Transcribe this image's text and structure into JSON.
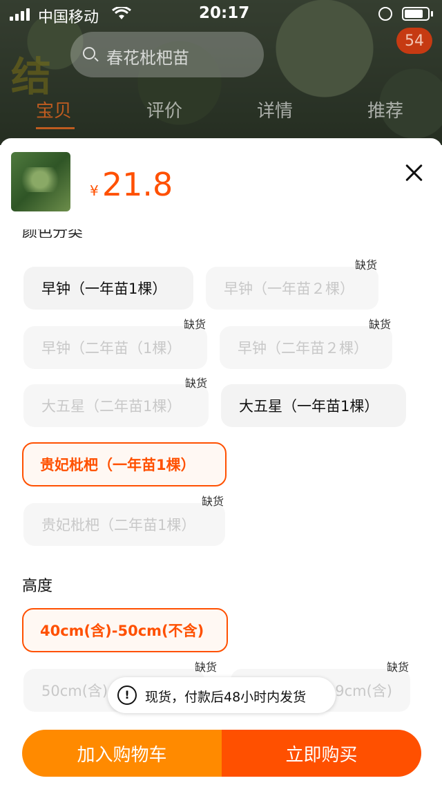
{
  "status_bar": {
    "carrier": "中国移动",
    "time": "20:17"
  },
  "background_page": {
    "search_placeholder": "春花枇杷苗",
    "cart_count": "54",
    "tabs": [
      "宝贝",
      "评价",
      "详情",
      "推荐"
    ],
    "active_tab": "宝贝",
    "watermark": "结"
  },
  "sheet": {
    "price_symbol": "¥",
    "price": "21.8",
    "section_color": "颜色分类",
    "color_options": [
      {
        "label": "早钟（一年苗1棵）",
        "state": "available"
      },
      {
        "label": "早钟（一年苗２棵）",
        "state": "disabled",
        "tag": "缺货"
      },
      {
        "label": "早钟（二年苗（1棵）",
        "state": "disabled",
        "tag": "缺货"
      },
      {
        "label": "早钟（二年苗２棵）",
        "state": "disabled",
        "tag": "缺货"
      },
      {
        "label": "大五星（二年苗1棵）",
        "state": "disabled",
        "tag": "缺货"
      },
      {
        "label": "大五星（一年苗1棵）",
        "state": "available"
      },
      {
        "label": "贵妃枇杷（一年苗1棵）",
        "state": "selected"
      },
      {
        "label": "贵妃枇杷（二年苗1棵）",
        "state": "disabled",
        "tag": "缺货"
      }
    ],
    "section_height": "高度",
    "height_options": [
      {
        "label": "40cm(含)-50cm(不含)",
        "state": "selected"
      },
      {
        "label": "50cm(含)",
        "state": "disabled",
        "tag": "缺货"
      },
      {
        "label": "9cm(含)",
        "state": "disabled",
        "tag": "缺货"
      }
    ],
    "toast": "现货，付款后48小时内发货",
    "add_to_cart": "加入购物车",
    "buy_now": "立即购买"
  },
  "colors": {
    "accent": "#ff5000",
    "cart_button": "#ff8a00"
  }
}
